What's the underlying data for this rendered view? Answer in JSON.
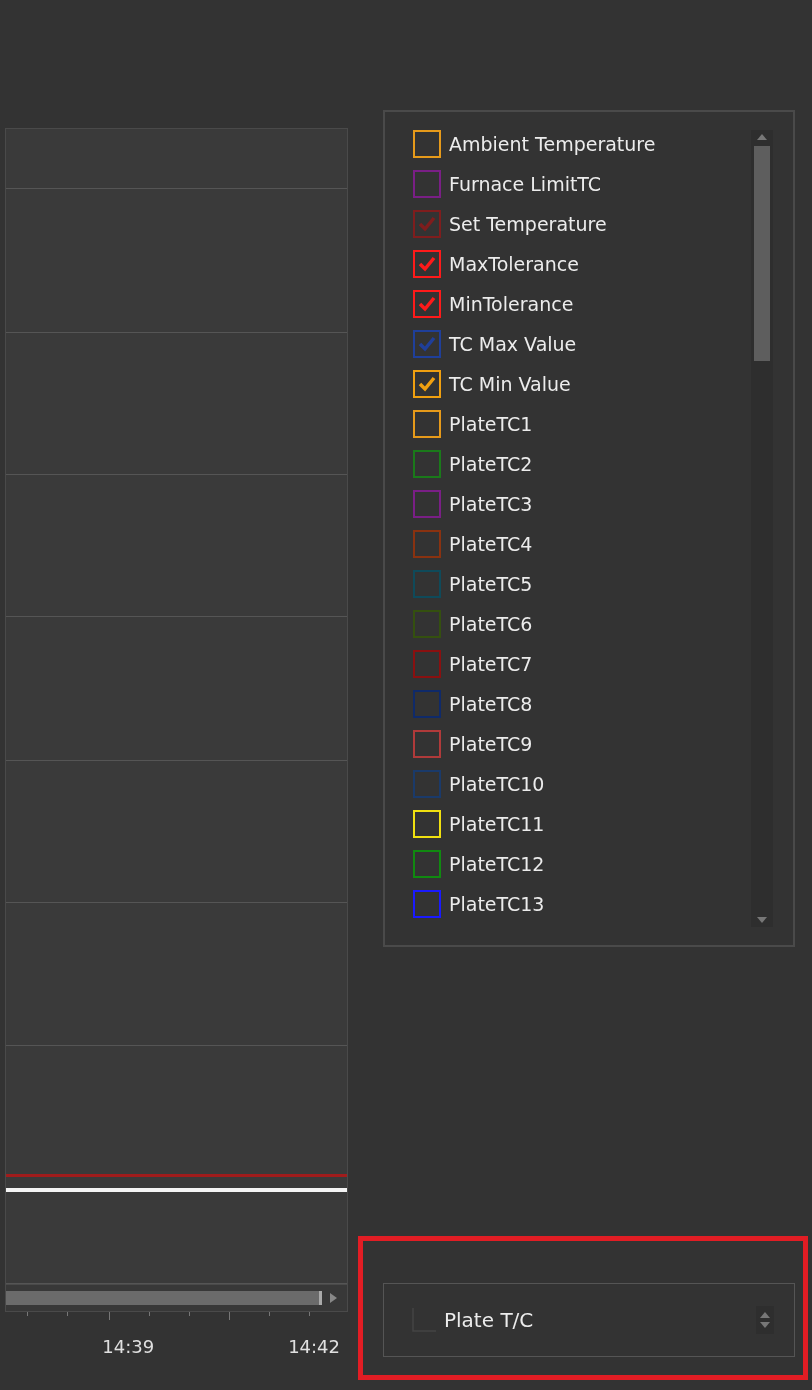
{
  "chart": {
    "x_axis_labels": [
      "14:39",
      "14:42"
    ]
  },
  "legend": {
    "items": [
      {
        "label": "Ambient Temperature",
        "color": "#e69a1a",
        "checked": false
      },
      {
        "label": "Furnace LimitTC",
        "color": "#7a1f86",
        "checked": false
      },
      {
        "label": "Set Temperature",
        "color": "#7f1d1d",
        "checked": true
      },
      {
        "label": "MaxTolerance",
        "color": "#ff1a1a",
        "checked": true
      },
      {
        "label": "MinTolerance",
        "color": "#ff1a1a",
        "checked": true
      },
      {
        "label": "TC Max Value",
        "color": "#1f3f9a",
        "checked": true
      },
      {
        "label": "TC Min Value",
        "color": "#f0a010",
        "checked": true
      },
      {
        "label": "PlateTC1",
        "color": "#e69a1a",
        "checked": false
      },
      {
        "label": "PlateTC2",
        "color": "#1a7a1a",
        "checked": false
      },
      {
        "label": "PlateTC3",
        "color": "#7a1f86",
        "checked": false
      },
      {
        "label": "PlateTC4",
        "color": "#8a3210",
        "checked": false
      },
      {
        "label": "PlateTC5",
        "color": "#0f4a5a",
        "checked": false
      },
      {
        "label": "PlateTC6",
        "color": "#34500f",
        "checked": false
      },
      {
        "label": "PlateTC7",
        "color": "#8a1010",
        "checked": false
      },
      {
        "label": "PlateTC8",
        "color": "#0f2a6a",
        "checked": false
      },
      {
        "label": "PlateTC9",
        "color": "#b03a3a",
        "checked": false
      },
      {
        "label": "PlateTC10",
        "color": "#1a3a6a",
        "checked": false
      },
      {
        "label": "PlateTC11",
        "color": "#f0e010",
        "checked": false
      },
      {
        "label": "PlateTC12",
        "color": "#108a10",
        "checked": false
      },
      {
        "label": "PlateTC13",
        "color": "#1a1aff",
        "checked": false
      }
    ]
  },
  "selector": {
    "value": "Plate T/C",
    "highlighted": true
  }
}
